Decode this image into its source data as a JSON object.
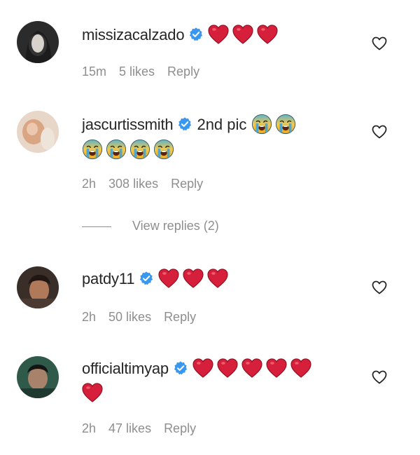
{
  "comments": [
    {
      "username": "missizacalzado",
      "verified": true,
      "text": "",
      "hearts": 3,
      "time": "15m",
      "likes": "5 likes",
      "reply": "Reply"
    },
    {
      "username": "jascurtissmith",
      "verified": true,
      "text": "2nd pic",
      "time": "2h",
      "likes": "308 likes",
      "reply": "Reply",
      "view_replies": "View replies (2)"
    },
    {
      "username": "patdy11",
      "verified": true,
      "text": "",
      "hearts": 3,
      "time": "2h",
      "likes": "50 likes",
      "reply": "Reply"
    },
    {
      "username": "officialtimyap",
      "verified": true,
      "text": "",
      "hearts": 6,
      "time": "2h",
      "likes": "47 likes",
      "reply": "Reply"
    }
  ],
  "icons": {
    "verified_color": "#3897f0",
    "heart_color": "#e0245e",
    "like_icon": "heart-outline-icon"
  }
}
